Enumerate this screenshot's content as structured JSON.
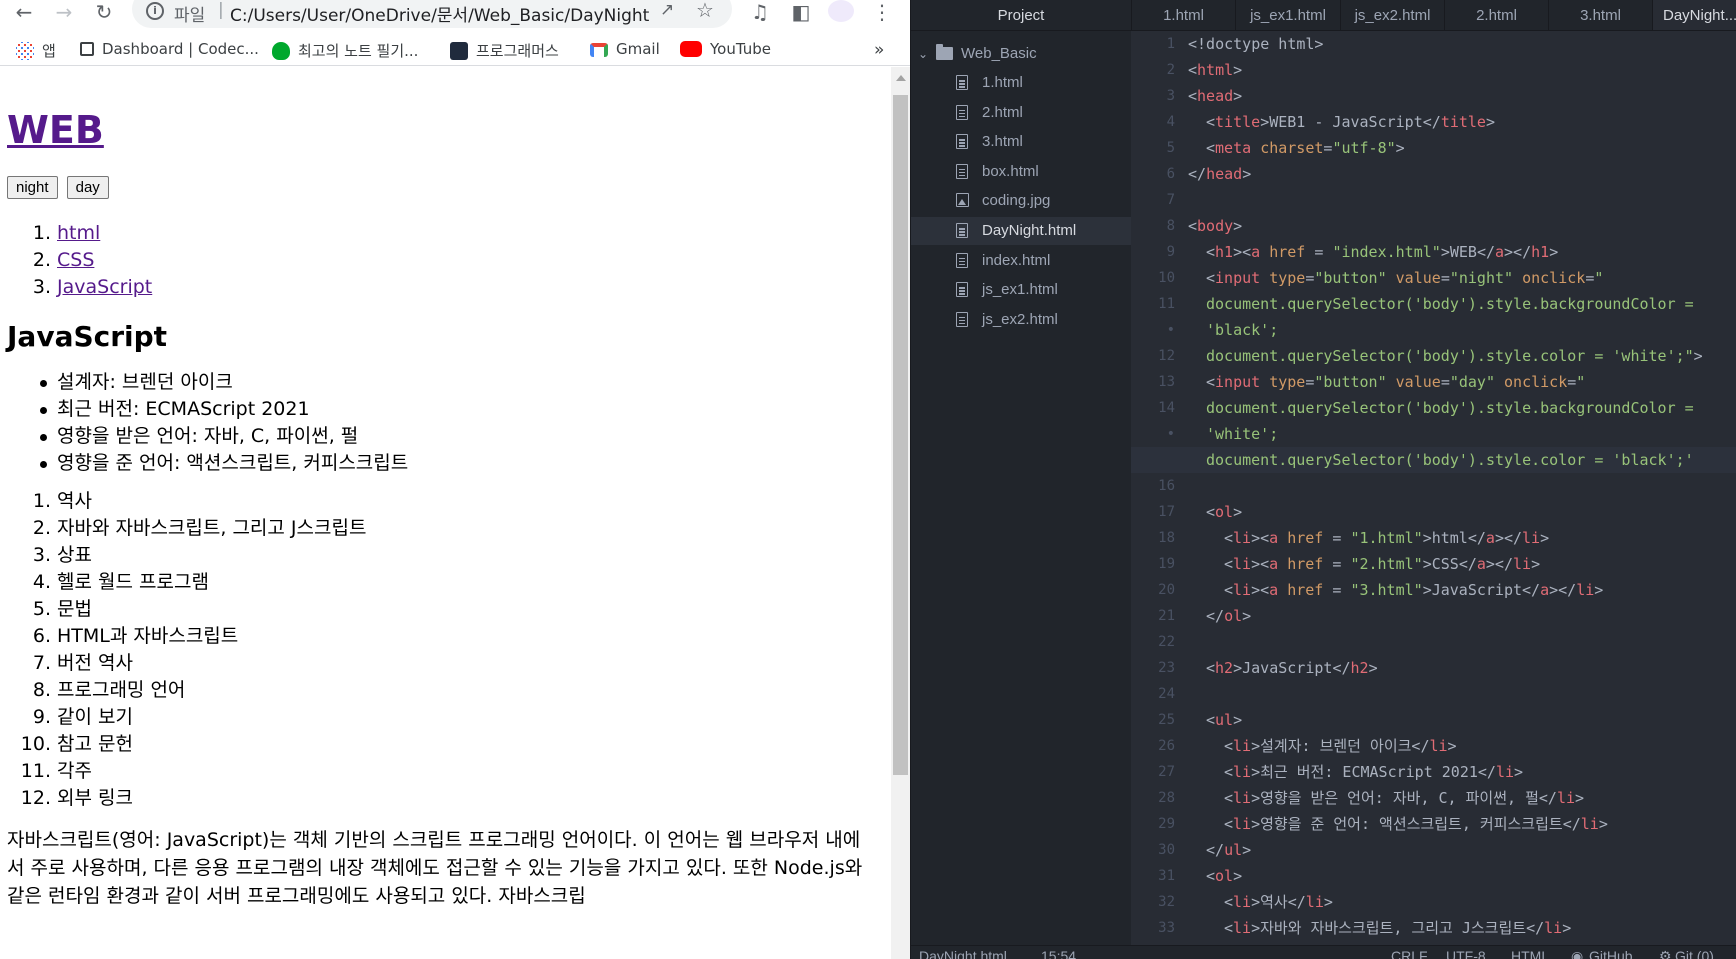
{
  "browser": {
    "address": {
      "scheme_label": "파일",
      "separator": "|",
      "url": "C:/Users/User/OneDrive/문서/Web_Basic/DayNight..."
    },
    "bookmarks": [
      {
        "label": "앱",
        "icon": "apps-grid-icon"
      },
      {
        "label": "Dashboard | Codec...",
        "icon": "codecademy-icon"
      },
      {
        "label": "최고의 노트 필기...",
        "icon": "evernote-icon"
      },
      {
        "label": "프로그래머스",
        "icon": "programmers-icon"
      },
      {
        "label": "Gmail",
        "icon": "gmail-icon"
      },
      {
        "label": "YouTube",
        "icon": "youtube-icon"
      }
    ],
    "bookmarks_overflow": "»"
  },
  "webpage": {
    "h1": "WEB",
    "buttons": [
      "night",
      "day"
    ],
    "nav": [
      {
        "num": "1.",
        "label": "html"
      },
      {
        "num": "2.",
        "label": "CSS"
      },
      {
        "num": "3.",
        "label": "JavaScript"
      }
    ],
    "h2": "JavaScript",
    "facts": [
      "설계자: 브렌던 아이크",
      "최근 버전: ECMAScript 2021",
      "영향을 받은 언어: 자바, C, 파이썬, 펄",
      "영향을 준 언어: 액션스크립트, 커피스크립트"
    ],
    "toc": [
      {
        "num": "1.",
        "label": "역사"
      },
      {
        "num": "2.",
        "label": "자바와 자바스크립트, 그리고 J스크립트"
      },
      {
        "num": "3.",
        "label": "상표"
      },
      {
        "num": "4.",
        "label": "헬로 월드 프로그램"
      },
      {
        "num": "5.",
        "label": "문법"
      },
      {
        "num": "6.",
        "label": "HTML과 자바스크립트"
      },
      {
        "num": "7.",
        "label": "버전 역사"
      },
      {
        "num": "8.",
        "label": "프로그래밍 언어"
      },
      {
        "num": "9.",
        "label": "같이 보기"
      },
      {
        "num": "10.",
        "label": "참고 문헌"
      },
      {
        "num": "11.",
        "label": "각주"
      },
      {
        "num": "12.",
        "label": "외부 링크"
      }
    ],
    "paragraph": "자바스크립트(영어: JavaScript)는 객체 기반의 스크립트 프로그래밍 언어이다. 이 언어는 웹 브라우저 내에서 주로 사용하며, 다른 응용 프로그램의 내장 객체에도 접근할 수 있는 기능을 가지고 있다. 또한 Node.js와 같은 런타임 환경과 같이 서버 프로그래밍에도 사용되고 있다. 자바스크립"
  },
  "editor": {
    "tree_title": "Project",
    "folder": "Web_Basic",
    "files": [
      {
        "name": "1.html",
        "type": "file"
      },
      {
        "name": "2.html",
        "type": "file"
      },
      {
        "name": "3.html",
        "type": "file"
      },
      {
        "name": "box.html",
        "type": "file"
      },
      {
        "name": "coding.jpg",
        "type": "image"
      },
      {
        "name": "DayNight.html",
        "type": "file",
        "selected": true
      },
      {
        "name": "index.html",
        "type": "file"
      },
      {
        "name": "js_ex1.html",
        "type": "file"
      },
      {
        "name": "js_ex2.html",
        "type": "file"
      }
    ],
    "tabs": [
      "1.html",
      "js_ex1.html",
      "js_ex2.html",
      "2.html",
      "3.html",
      "DayNight..."
    ],
    "active_tab": 5,
    "current_line": "15",
    "lines": [
      {
        "n": "1",
        "indent": 0,
        "tokens": [
          [
            "p",
            "<!doctype html>"
          ]
        ]
      },
      {
        "n": "2",
        "indent": 0,
        "tokens": [
          [
            "p",
            "<"
          ],
          [
            "tag",
            "html"
          ],
          [
            "p",
            ">"
          ]
        ]
      },
      {
        "n": "3",
        "indent": 0,
        "tokens": [
          [
            "p",
            "<"
          ],
          [
            "tag",
            "head"
          ],
          [
            "p",
            ">"
          ]
        ]
      },
      {
        "n": "4",
        "indent": 2,
        "tokens": [
          [
            "p",
            "<"
          ],
          [
            "tag",
            "title"
          ],
          [
            "p",
            ">"
          ],
          [
            "txt",
            "WEB1 - JavaScript"
          ],
          [
            "p",
            "</"
          ],
          [
            "tag",
            "title"
          ],
          [
            "p",
            ">"
          ]
        ]
      },
      {
        "n": "5",
        "indent": 2,
        "tokens": [
          [
            "p",
            "<"
          ],
          [
            "tag",
            "meta"
          ],
          [
            "p",
            " "
          ],
          [
            "attr",
            "charset"
          ],
          [
            "p",
            "="
          ],
          [
            "str",
            "\"utf-8\""
          ],
          [
            "p",
            ">"
          ]
        ]
      },
      {
        "n": "6",
        "indent": 0,
        "tokens": [
          [
            "p",
            "</"
          ],
          [
            "tag",
            "head"
          ],
          [
            "p",
            ">"
          ]
        ]
      },
      {
        "n": "7",
        "indent": 0,
        "tokens": []
      },
      {
        "n": "8",
        "indent": 0,
        "tokens": [
          [
            "p",
            "<"
          ],
          [
            "tag",
            "body"
          ],
          [
            "p",
            ">"
          ]
        ]
      },
      {
        "n": "9",
        "indent": 2,
        "tokens": [
          [
            "p",
            "<"
          ],
          [
            "tag",
            "h1"
          ],
          [
            "p",
            "><"
          ],
          [
            "tag",
            "a"
          ],
          [
            "p",
            " "
          ],
          [
            "attr",
            "href"
          ],
          [
            "p",
            " = "
          ],
          [
            "str",
            "\"index.html\""
          ],
          [
            "p",
            ">"
          ],
          [
            "txt",
            "WEB"
          ],
          [
            "p",
            "</"
          ],
          [
            "tag",
            "a"
          ],
          [
            "p",
            "></"
          ],
          [
            "tag",
            "h1"
          ],
          [
            "p",
            ">"
          ]
        ]
      },
      {
        "n": "10",
        "indent": 2,
        "tokens": [
          [
            "p",
            "<"
          ],
          [
            "tag",
            "input"
          ],
          [
            "p",
            " "
          ],
          [
            "attr",
            "type"
          ],
          [
            "p",
            "="
          ],
          [
            "str",
            "\"button\""
          ],
          [
            "p",
            " "
          ],
          [
            "attr",
            "value"
          ],
          [
            "p",
            "="
          ],
          [
            "str",
            "\"night\""
          ],
          [
            "p",
            " "
          ],
          [
            "attr",
            "onclick"
          ],
          [
            "p",
            "="
          ],
          [
            "str",
            "\""
          ]
        ]
      },
      {
        "n": "11",
        "indent": 2,
        "tokens": [
          [
            "str",
            "document.querySelector('body').style.backgroundColor ="
          ]
        ]
      },
      {
        "n": "•",
        "indent": 2,
        "tokens": [
          [
            "str",
            "'black';"
          ]
        ]
      },
      {
        "n": "12",
        "indent": 2,
        "tokens": [
          [
            "str",
            "document.querySelector('body').style.color = 'white';\""
          ],
          [
            "p",
            ">"
          ]
        ]
      },
      {
        "n": "13",
        "indent": 2,
        "tokens": [
          [
            "p",
            "<"
          ],
          [
            "tag",
            "input"
          ],
          [
            "p",
            " "
          ],
          [
            "attr",
            "type"
          ],
          [
            "p",
            "="
          ],
          [
            "str",
            "\"button\""
          ],
          [
            "p",
            " "
          ],
          [
            "attr",
            "value"
          ],
          [
            "p",
            "="
          ],
          [
            "str",
            "\"day\""
          ],
          [
            "p",
            " "
          ],
          [
            "attr",
            "onclick"
          ],
          [
            "p",
            "="
          ],
          [
            "str",
            "\""
          ]
        ]
      },
      {
        "n": "14",
        "indent": 2,
        "tokens": [
          [
            "str",
            "document.querySelector('body').style.backgroundColor ="
          ]
        ]
      },
      {
        "n": "•",
        "indent": 2,
        "tokens": [
          [
            "str",
            "'white';"
          ]
        ]
      },
      {
        "n": "15",
        "indent": 2,
        "current": true,
        "tokens": [
          [
            "str",
            "document.querySelector('body').style.color = 'black';'"
          ]
        ]
      },
      {
        "n": "16",
        "indent": 0,
        "tokens": []
      },
      {
        "n": "17",
        "indent": 2,
        "tokens": [
          [
            "p",
            "<"
          ],
          [
            "tag",
            "ol"
          ],
          [
            "p",
            ">"
          ]
        ]
      },
      {
        "n": "18",
        "indent": 4,
        "tokens": [
          [
            "p",
            "<"
          ],
          [
            "tag",
            "li"
          ],
          [
            "p",
            "><"
          ],
          [
            "tag",
            "a"
          ],
          [
            "p",
            " "
          ],
          [
            "attr",
            "href"
          ],
          [
            "p",
            " = "
          ],
          [
            "str",
            "\"1.html\""
          ],
          [
            "p",
            ">"
          ],
          [
            "txt",
            "html"
          ],
          [
            "p",
            "</"
          ],
          [
            "tag",
            "a"
          ],
          [
            "p",
            "></"
          ],
          [
            "tag",
            "li"
          ],
          [
            "p",
            ">"
          ]
        ]
      },
      {
        "n": "19",
        "indent": 4,
        "tokens": [
          [
            "p",
            "<"
          ],
          [
            "tag",
            "li"
          ],
          [
            "p",
            "><"
          ],
          [
            "tag",
            "a"
          ],
          [
            "p",
            " "
          ],
          [
            "attr",
            "href"
          ],
          [
            "p",
            " = "
          ],
          [
            "str",
            "\"2.html\""
          ],
          [
            "p",
            ">"
          ],
          [
            "txt",
            "CSS"
          ],
          [
            "p",
            "</"
          ],
          [
            "tag",
            "a"
          ],
          [
            "p",
            "></"
          ],
          [
            "tag",
            "li"
          ],
          [
            "p",
            ">"
          ]
        ]
      },
      {
        "n": "20",
        "indent": 4,
        "tokens": [
          [
            "p",
            "<"
          ],
          [
            "tag",
            "li"
          ],
          [
            "p",
            "><"
          ],
          [
            "tag",
            "a"
          ],
          [
            "p",
            " "
          ],
          [
            "attr",
            "href"
          ],
          [
            "p",
            " = "
          ],
          [
            "str",
            "\"3.html\""
          ],
          [
            "p",
            ">"
          ],
          [
            "txt",
            "JavaScript"
          ],
          [
            "p",
            "</"
          ],
          [
            "tag",
            "a"
          ],
          [
            "p",
            "></"
          ],
          [
            "tag",
            "li"
          ],
          [
            "p",
            ">"
          ]
        ]
      },
      {
        "n": "21",
        "indent": 2,
        "tokens": [
          [
            "p",
            "</"
          ],
          [
            "tag",
            "ol"
          ],
          [
            "p",
            ">"
          ]
        ]
      },
      {
        "n": "22",
        "indent": 0,
        "tokens": []
      },
      {
        "n": "23",
        "indent": 2,
        "tokens": [
          [
            "p",
            "<"
          ],
          [
            "tag",
            "h2"
          ],
          [
            "p",
            ">"
          ],
          [
            "txt",
            "JavaScript"
          ],
          [
            "p",
            "</"
          ],
          [
            "tag",
            "h2"
          ],
          [
            "p",
            ">"
          ]
        ]
      },
      {
        "n": "24",
        "indent": 0,
        "tokens": []
      },
      {
        "n": "25",
        "indent": 2,
        "tokens": [
          [
            "p",
            "<"
          ],
          [
            "tag",
            "ul"
          ],
          [
            "p",
            ">"
          ]
        ]
      },
      {
        "n": "26",
        "indent": 4,
        "tokens": [
          [
            "p",
            "<"
          ],
          [
            "tag",
            "li"
          ],
          [
            "p",
            ">"
          ],
          [
            "txt",
            "설계자: 브렌던 아이크"
          ],
          [
            "p",
            "</"
          ],
          [
            "tag",
            "li"
          ],
          [
            "p",
            ">"
          ]
        ]
      },
      {
        "n": "27",
        "indent": 4,
        "tokens": [
          [
            "p",
            "<"
          ],
          [
            "tag",
            "li"
          ],
          [
            "p",
            ">"
          ],
          [
            "txt",
            "최근 버전: ECMAScript 2021"
          ],
          [
            "p",
            "</"
          ],
          [
            "tag",
            "li"
          ],
          [
            "p",
            ">"
          ]
        ]
      },
      {
        "n": "28",
        "indent": 4,
        "tokens": [
          [
            "p",
            "<"
          ],
          [
            "tag",
            "li"
          ],
          [
            "p",
            ">"
          ],
          [
            "txt",
            "영향을 받은 언어: 자바, C, 파이썬, 펄"
          ],
          [
            "p",
            "</"
          ],
          [
            "tag",
            "li"
          ],
          [
            "p",
            ">"
          ]
        ]
      },
      {
        "n": "29",
        "indent": 4,
        "tokens": [
          [
            "p",
            "<"
          ],
          [
            "tag",
            "li"
          ],
          [
            "p",
            ">"
          ],
          [
            "txt",
            "영향을 준 언어: 액션스크립트, 커피스크립트"
          ],
          [
            "p",
            "</"
          ],
          [
            "tag",
            "li"
          ],
          [
            "p",
            ">"
          ]
        ]
      },
      {
        "n": "30",
        "indent": 2,
        "tokens": [
          [
            "p",
            "</"
          ],
          [
            "tag",
            "ul"
          ],
          [
            "p",
            ">"
          ]
        ]
      },
      {
        "n": "31",
        "indent": 2,
        "tokens": [
          [
            "p",
            "<"
          ],
          [
            "tag",
            "ol"
          ],
          [
            "p",
            ">"
          ]
        ]
      },
      {
        "n": "32",
        "indent": 4,
        "tokens": [
          [
            "p",
            "<"
          ],
          [
            "tag",
            "li"
          ],
          [
            "p",
            ">"
          ],
          [
            "txt",
            "역사"
          ],
          [
            "p",
            "</"
          ],
          [
            "tag",
            "li"
          ],
          [
            "p",
            ">"
          ]
        ]
      },
      {
        "n": "33",
        "indent": 4,
        "tokens": [
          [
            "p",
            "<"
          ],
          [
            "tag",
            "li"
          ],
          [
            "p",
            ">"
          ],
          [
            "txt",
            "자바와 자바스크립트, 그리고 J스크립트"
          ],
          [
            "p",
            "</"
          ],
          [
            "tag",
            "li"
          ],
          [
            "p",
            ">"
          ]
        ]
      }
    ],
    "status": {
      "file": "DayNight.html",
      "cursor": "15:54",
      "line_ending": "CRLF",
      "encoding": "UTF-8",
      "grammar": "HTML",
      "github": "GitHub",
      "git": "Git (0)"
    }
  },
  "colors": {
    "tag": "#e06c75",
    "attr": "#d19a66",
    "string": "#98c379",
    "link_visited": "#551a8b"
  }
}
